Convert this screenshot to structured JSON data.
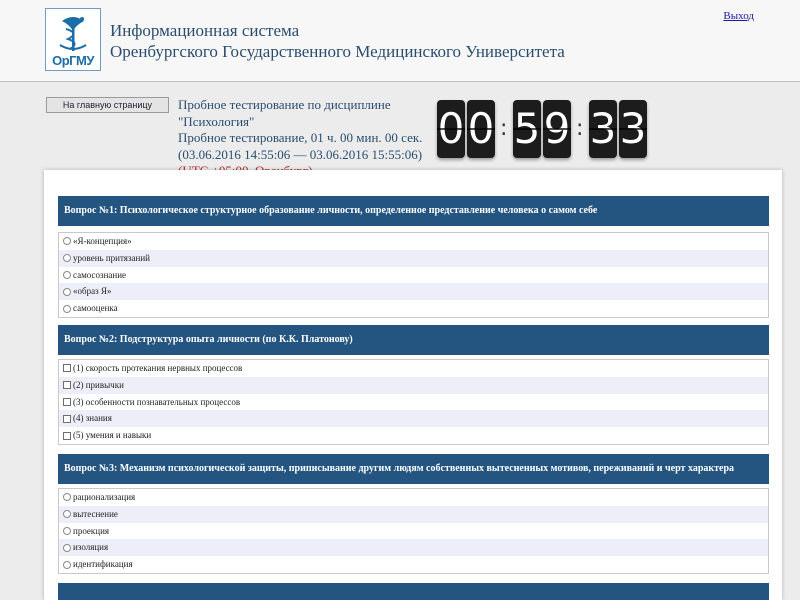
{
  "header": {
    "logo_text": "ОрГМУ",
    "title_line1": "Информационная система",
    "title_line2": "Оренбургского Государственного Медицинского Университета",
    "logout_label": "Выход"
  },
  "nav": {
    "home_button": "На главную страницу"
  },
  "test_info": {
    "line1": "Пробное тестирование по дисциплине \"Психология\"",
    "line2": "Пробное тестирование, 01 ч. 00 мин. 00 сек.",
    "line3": "(03.06.2016 14:55:06 — 03.06.2016 15:55:06)",
    "timezone": "(UTC +05:00, Оренбург)"
  },
  "timer": {
    "h1": "0",
    "h2": "0",
    "m1": "5",
    "m2": "9",
    "s1": "3",
    "s2": "3",
    "sep": ":"
  },
  "questions": [
    {
      "title": "Вопрос №1: Психологическое структурное образование личности, определенное представление человека о самом себе",
      "type": "radio",
      "answers": [
        "«Я-концепция»",
        "уровень притязаний",
        "самосознание",
        "«образ Я»",
        "самооценка"
      ]
    },
    {
      "title": "Вопрос №2: Подструктура опыта личности (по К.К. Платонову)",
      "type": "checkbox",
      "answers": [
        "(1) скорость протекания нервных процессов",
        "(2) привычки",
        "(3) особенности познавательных процессов",
        "(4) знания",
        "(5) умения и навыки"
      ]
    },
    {
      "title": "Вопрос №3: Механизм психологической защиты, приписывание другим людям собственных вытесненных мотивов, переживаний и черт характера",
      "type": "radio",
      "answers": [
        "рационализация",
        "вытеснение",
        "проекция",
        "изоляция",
        "идентификация"
      ]
    }
  ],
  "colors": {
    "question_header": "#245580",
    "title_text": "#2a4d6e",
    "timezone": "#b22a2a",
    "alt_row": "#eeeef8"
  }
}
